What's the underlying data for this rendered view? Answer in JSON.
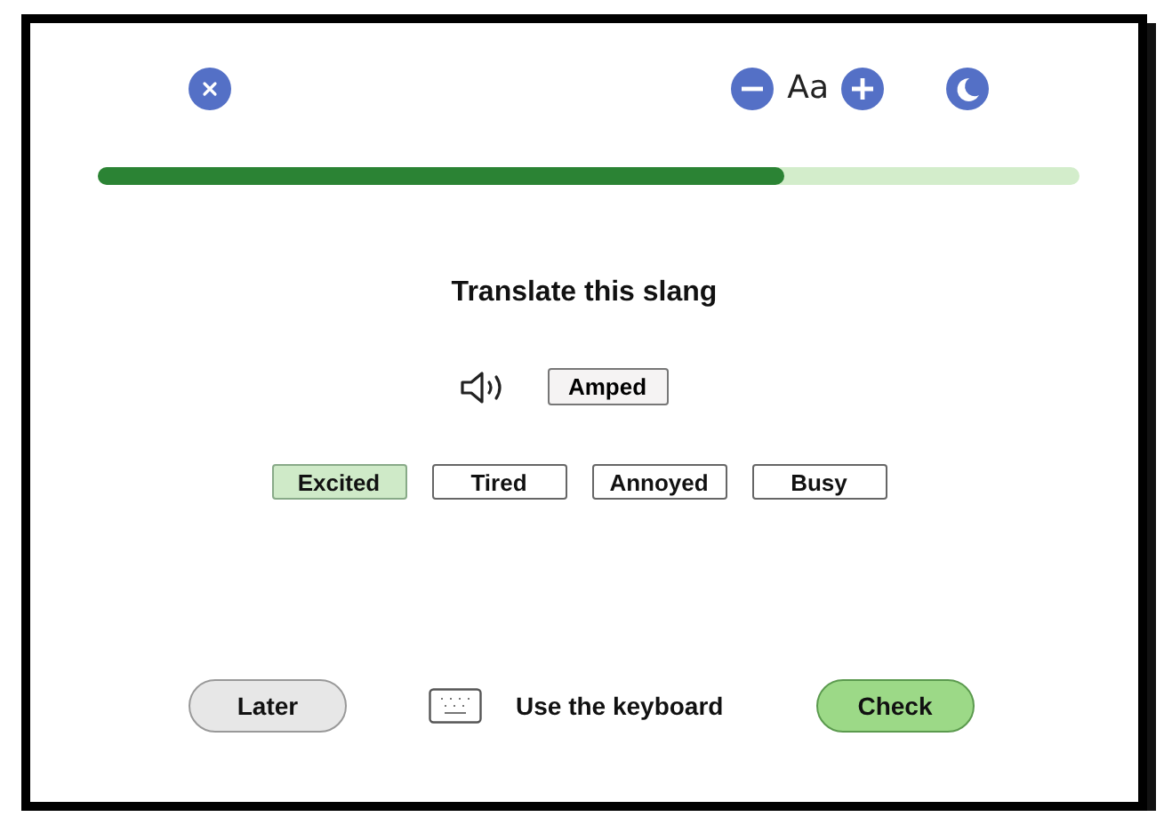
{
  "font_size_label": "Aa",
  "progress": {
    "level": 0.7
  },
  "prompt": "Translate this slang",
  "word": "Amped",
  "options": [
    {
      "label": "Excited",
      "selected": true
    },
    {
      "label": "Tired",
      "selected": false
    },
    {
      "label": "Annoyed",
      "selected": false
    },
    {
      "label": "Busy",
      "selected": false
    }
  ],
  "footer": {
    "later": "Later",
    "keyboard": "Use the keyboard",
    "check": "Check"
  }
}
